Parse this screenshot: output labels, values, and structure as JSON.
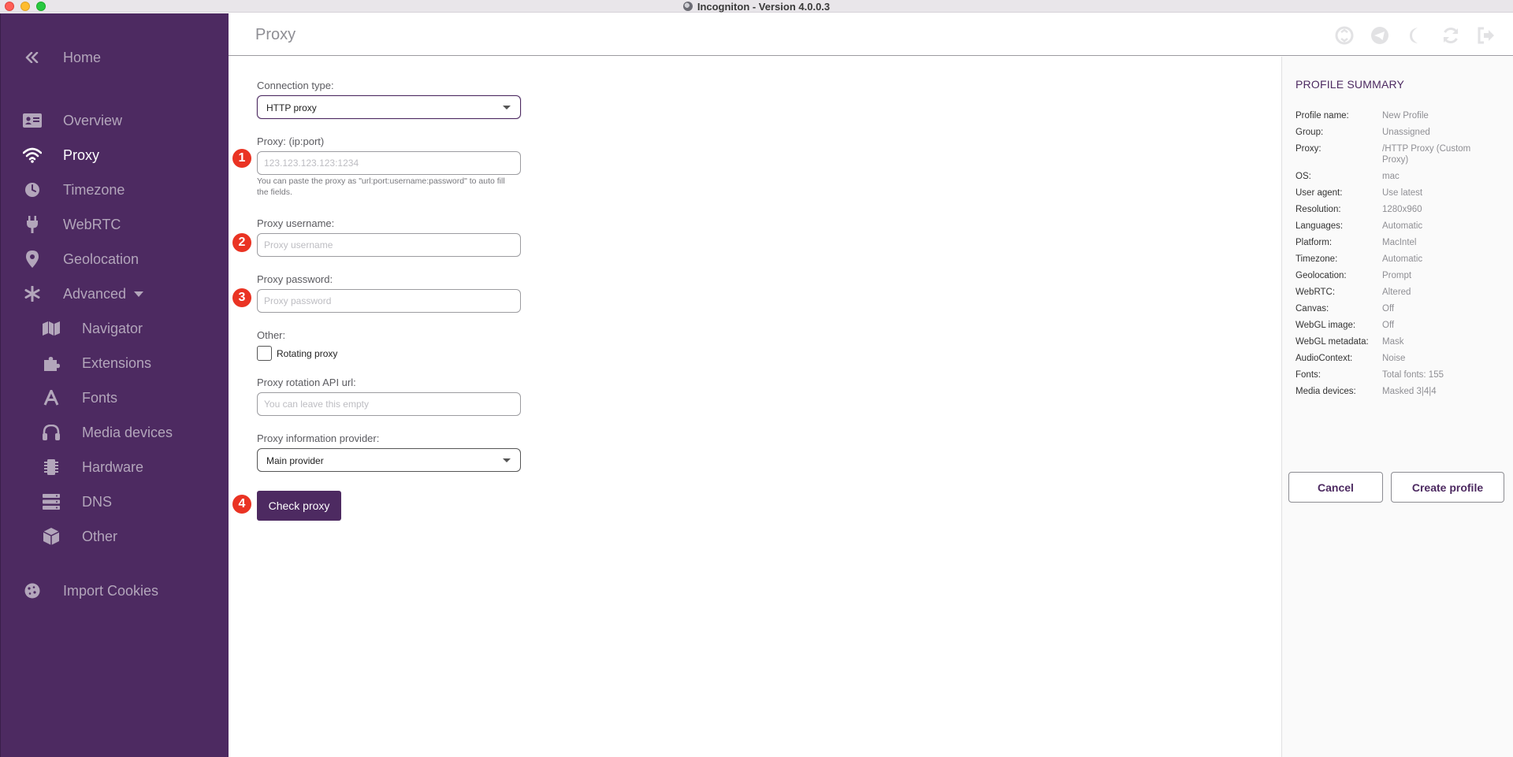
{
  "window": {
    "title": "Incogniton - Version 4.0.0.3"
  },
  "sidebar": {
    "home": "Home",
    "items": [
      {
        "label": "Overview",
        "icon": "id-card-icon"
      },
      {
        "label": "Proxy",
        "icon": "wifi-icon"
      },
      {
        "label": "Timezone",
        "icon": "clock-icon"
      },
      {
        "label": "WebRTC",
        "icon": "plug-icon"
      },
      {
        "label": "Geolocation",
        "icon": "map-pin-icon"
      },
      {
        "label": "Advanced",
        "icon": "asterisk-icon"
      }
    ],
    "advanced_items": [
      {
        "label": "Navigator",
        "icon": "map-icon"
      },
      {
        "label": "Extensions",
        "icon": "puzzle-icon"
      },
      {
        "label": "Fonts",
        "icon": "font-icon"
      },
      {
        "label": "Media devices",
        "icon": "headphones-icon"
      },
      {
        "label": "Hardware",
        "icon": "chip-icon"
      },
      {
        "label": "DNS",
        "icon": "server-icon"
      },
      {
        "label": "Other",
        "icon": "box-icon"
      }
    ],
    "import_cookies": "Import Cookies",
    "active": "Proxy"
  },
  "header": {
    "title": "Proxy"
  },
  "form": {
    "connection_type_label": "Connection type:",
    "connection_type_value": "HTTP proxy",
    "proxy_label": "Proxy: (ip:port)",
    "proxy_placeholder": "123.123.123.123:1234",
    "proxy_hint": "You can paste the proxy as \"url:port:username:password\" to auto fill the fields.",
    "username_label": "Proxy username:",
    "username_placeholder": "Proxy username",
    "password_label": "Proxy password:",
    "password_placeholder": "Proxy password",
    "other_label": "Other:",
    "rotating_label": "Rotating proxy",
    "rotation_url_label": "Proxy rotation API url:",
    "rotation_url_placeholder": "You can leave this empty",
    "info_provider_label": "Proxy information provider:",
    "info_provider_value": "Main provider",
    "check_button": "Check proxy"
  },
  "badges": [
    "1",
    "2",
    "3",
    "4"
  ],
  "summary": {
    "title": "PROFILE SUMMARY",
    "rows": [
      {
        "key": "Profile name:",
        "value": "New Profile"
      },
      {
        "key": "Group:",
        "value": "Unassigned"
      },
      {
        "key": "Proxy:",
        "value": "/HTTP Proxy (Custom Proxy)"
      },
      {
        "key": "OS:",
        "value": "mac"
      },
      {
        "key": "User agent:",
        "value": "Use latest"
      },
      {
        "key": "Resolution:",
        "value": "1280x960"
      },
      {
        "key": "Languages:",
        "value": "Automatic"
      },
      {
        "key": "Platform:",
        "value": "MacIntel"
      },
      {
        "key": "Timezone:",
        "value": "Automatic"
      },
      {
        "key": "Geolocation:",
        "value": "Prompt"
      },
      {
        "key": "WebRTC:",
        "value": "Altered"
      },
      {
        "key": "Canvas:",
        "value": "Off"
      },
      {
        "key": "WebGL image:",
        "value": "Off"
      },
      {
        "key": "WebGL metadata:",
        "value": "Mask"
      },
      {
        "key": "AudioContext:",
        "value": "Noise"
      },
      {
        "key": "Fonts:",
        "value": "Total fonts: 155"
      },
      {
        "key": "Media devices:",
        "value": "Masked 3|4|4"
      }
    ],
    "cancel": "Cancel",
    "create": "Create profile"
  },
  "colors": {
    "sidebar_bg": "#4d2a61",
    "accent": "#4d2a61",
    "badge": "#ea3323"
  }
}
